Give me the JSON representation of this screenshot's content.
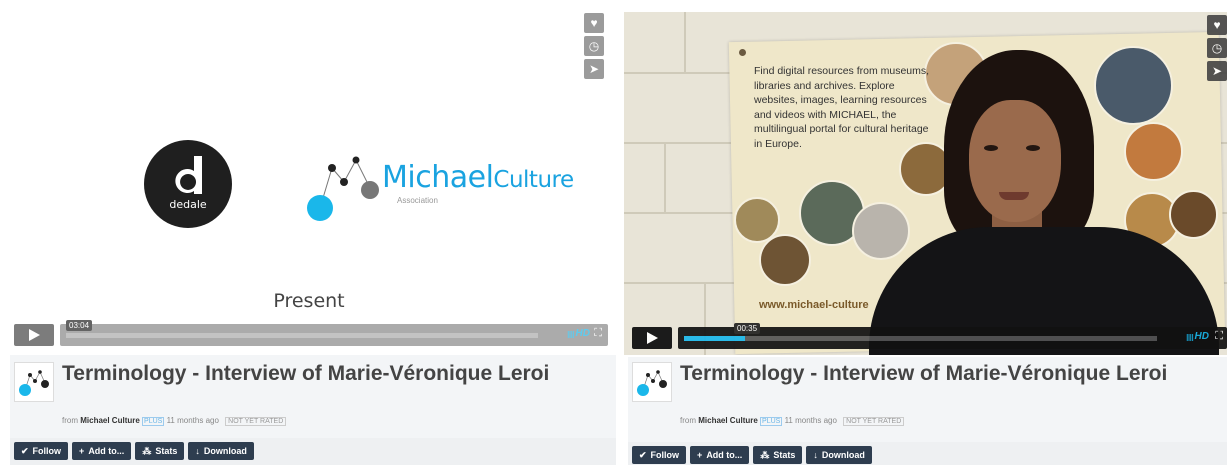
{
  "panels": [
    {
      "video": {
        "slide": {
          "dedale_label": "dedale",
          "brand_main": "Michael",
          "brand_culture": "Culture",
          "brand_sub": "Association",
          "present": "Present"
        },
        "time": "03:04",
        "hd": "HD",
        "progress": 0.0
      },
      "title": "Terminology - Interview of Marie-Véronique Leroi",
      "byline": {
        "from": "from",
        "author": "Michael Culture",
        "plus": "PLUS",
        "age": "11 months ago",
        "rating": "NOT YET RATED"
      },
      "actions": {
        "follow": "Follow",
        "add": "Add to...",
        "stats": "Stats",
        "download": "Download"
      }
    },
    {
      "video": {
        "poster_text": "Find digital resources from museums, libraries and archives. Explore websites, images, learning resources and videos with MICHAEL, the multilingual portal for cultural heritage in Europe.",
        "poster_url": "www.michael-culture",
        "time": "00:35",
        "hd": "HD",
        "progress": 0.13
      },
      "title": "Terminology - Interview of Marie-Véronique Leroi",
      "byline": {
        "from": "from",
        "author": "Michael Culture",
        "plus": "PLUS",
        "age": "11 months ago",
        "rating": "NOT YET RATED"
      },
      "actions": {
        "follow": "Follow",
        "add": "Add to...",
        "stats": "Stats",
        "download": "Download"
      }
    }
  ],
  "icons": {
    "like": "heart-icon",
    "later": "clock-icon",
    "share": "send-icon",
    "play": "play-icon",
    "fullscreen": "fullscreen-icon"
  },
  "colors": {
    "accent": "#1ab7ea",
    "button_bg": "#2e3d4f"
  }
}
